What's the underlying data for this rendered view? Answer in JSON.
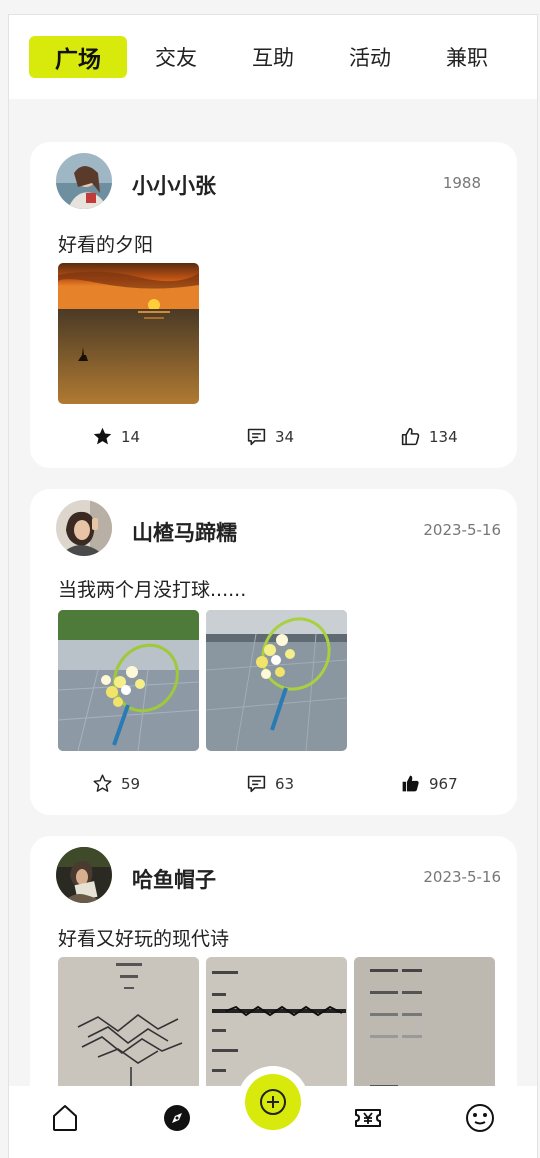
{
  "tabs": [
    {
      "label": "广场",
      "active": true
    },
    {
      "label": "交友",
      "active": false
    },
    {
      "label": "互助",
      "active": false
    },
    {
      "label": "活动",
      "active": false
    },
    {
      "label": "兼职",
      "active": false
    }
  ],
  "posts": [
    {
      "username": "小小小张",
      "date": "1988",
      "text": "好看的夕阳",
      "favorites": "14",
      "comments": "34",
      "likes": "134",
      "favorited": true,
      "liked": false
    },
    {
      "username": "山楂马蹄糯",
      "date": "2023-5-16",
      "text": "当我两个月没打球......",
      "favorites": "59",
      "comments": "63",
      "likes": "967",
      "favorited": false,
      "liked": true
    },
    {
      "username": "哈鱼帽子",
      "date": "2023-5-16",
      "text": "好看又好玩的现代诗",
      "favorites": "",
      "comments": "",
      "likes": ""
    }
  ],
  "bottom_nav": [
    {
      "icon": "home-icon"
    },
    {
      "icon": "compass-icon"
    },
    {
      "icon": "add-post-icon"
    },
    {
      "icon": "ticket-yen-icon"
    },
    {
      "icon": "smiley-face-icon"
    }
  ],
  "colors": {
    "accent": "#d7ea0b",
    "background": "#f5f5f5",
    "card": "#ffffff",
    "text": "#222222",
    "muted": "#777777"
  }
}
